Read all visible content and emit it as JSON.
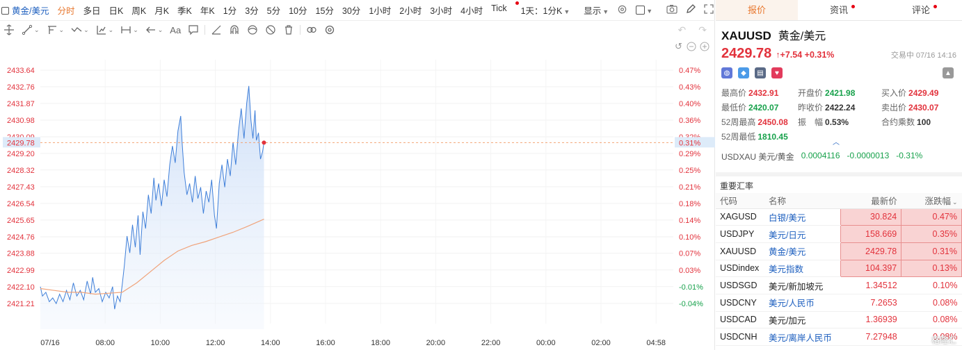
{
  "period_bar": {
    "symbol": "黄金/美元",
    "items": [
      "分时",
      "多日",
      "日K",
      "周K",
      "月K",
      "季K",
      "年K",
      "1分",
      "3分",
      "5分",
      "10分",
      "15分",
      "30分",
      "1小时",
      "2小时",
      "3小时",
      "4小时",
      "Tick"
    ],
    "active_index": 0,
    "combo": "1天：1分K",
    "display": "显示"
  },
  "drawing_tools": [
    "crosshair",
    "line",
    "polyline",
    "trend",
    "fib",
    "measure",
    "arrow",
    "text",
    "comment",
    "ruler",
    "magnet",
    "eye",
    "hide",
    "delete",
    "link",
    "settings"
  ],
  "chart_data": {
    "type": "line",
    "date_label": "07/16",
    "x_ticks": [
      "07/16",
      "08:00",
      "10:00",
      "12:00",
      "14:00",
      "16:00",
      "18:00",
      "20:00",
      "22:00",
      "00:00",
      "02:00",
      "04:58"
    ],
    "y_left_ticks": [
      "2433.64",
      "2432.76",
      "2431.87",
      "2430.98",
      "2430.09",
      "2429.20",
      "2428.32",
      "2427.43",
      "2426.54",
      "2425.65",
      "2424.76",
      "2423.88",
      "2422.99",
      "2422.10",
      "2421.21"
    ],
    "y_right_ticks": [
      "0.47%",
      "0.43%",
      "0.40%",
      "0.36%",
      "0.32%",
      "0.29%",
      "0.25%",
      "0.21%",
      "0.18%",
      "0.14%",
      "0.10%",
      "0.07%",
      "0.03%",
      "-0.01%",
      "-0.04%"
    ],
    "ylim": [
      2420.5,
      2434.2
    ],
    "last_price": "2429.78",
    "last_pct": "0.31%",
    "price_series": [
      [
        0,
        2422.1
      ],
      [
        3,
        2421.6
      ],
      [
        8,
        2421.8
      ],
      [
        13,
        2421.3
      ],
      [
        18,
        2421.5
      ],
      [
        23,
        2421.2
      ],
      [
        28,
        2421.7
      ],
      [
        33,
        2421.3
      ],
      [
        38,
        2421.9
      ],
      [
        43,
        2421.4
      ],
      [
        48,
        2422.3
      ],
      [
        53,
        2421.6
      ],
      [
        58,
        2421.9
      ],
      [
        63,
        2421.4
      ],
      [
        68,
        2422.4
      ],
      [
        73,
        2421.7
      ],
      [
        76,
        2422.6
      ],
      [
        80,
        2421.8
      ],
      [
        85,
        2422.0
      ],
      [
        90,
        2421.3
      ],
      [
        95,
        2421.8
      ],
      [
        100,
        2421.5
      ],
      [
        105,
        2422.1
      ],
      [
        108,
        2420.9
      ],
      [
        112,
        2421.6
      ],
      [
        116,
        2421.3
      ],
      [
        119,
        2422.2
      ],
      [
        122,
        2423.2
      ],
      [
        126,
        2424.8
      ],
      [
        130,
        2423.9
      ],
      [
        134,
        2425.4
      ],
      [
        138,
        2424.2
      ],
      [
        142,
        2425.9
      ],
      [
        145,
        2423.8
      ],
      [
        149,
        2426.1
      ],
      [
        153,
        2425.2
      ],
      [
        157,
        2427.0
      ],
      [
        161,
        2426.0
      ],
      [
        165,
        2427.9
      ],
      [
        168,
        2426.7
      ],
      [
        172,
        2427.6
      ],
      [
        176,
        2426.4
      ],
      [
        180,
        2427.8
      ],
      [
        184,
        2426.9
      ],
      [
        188,
        2428.6
      ],
      [
        192,
        2429.6
      ],
      [
        196,
        2428.7
      ],
      [
        200,
        2430.4
      ],
      [
        204,
        2431.2
      ],
      [
        206,
        2429.8
      ],
      [
        209,
        2428.2
      ],
      [
        213,
        2427.0
      ],
      [
        217,
        2427.6
      ],
      [
        221,
        2426.6
      ],
      [
        225,
        2428.0
      ],
      [
        229,
        2426.8
      ],
      [
        233,
        2427.4
      ],
      [
        237,
        2426.0
      ],
      [
        241,
        2427.2
      ],
      [
        245,
        2426.6
      ],
      [
        249,
        2427.8
      ],
      [
        253,
        2425.9
      ],
      [
        256,
        2425.2
      ],
      [
        260,
        2427.6
      ],
      [
        264,
        2428.6
      ],
      [
        268,
        2427.4
      ],
      [
        272,
        2428.9
      ],
      [
        276,
        2428.0
      ],
      [
        280,
        2429.8
      ],
      [
        284,
        2428.6
      ],
      [
        288,
        2430.4
      ],
      [
        292,
        2431.6
      ],
      [
        296,
        2430.0
      ],
      [
        300,
        2431.9
      ],
      [
        303,
        2432.8
      ],
      [
        306,
        2431.0
      ],
      [
        309,
        2430.0
      ],
      [
        312,
        2431.5
      ],
      [
        314,
        2429.9
      ],
      [
        317,
        2430.3
      ],
      [
        320,
        2428.9
      ],
      [
        323,
        2429.3
      ],
      [
        325,
        2429.8
      ]
    ],
    "avg_series": [
      [
        0,
        2422.0
      ],
      [
        20,
        2421.9
      ],
      [
        40,
        2421.8
      ],
      [
        60,
        2421.8
      ],
      [
        80,
        2421.7
      ],
      [
        100,
        2421.75
      ],
      [
        119,
        2421.8
      ],
      [
        140,
        2422.3
      ],
      [
        160,
        2422.9
      ],
      [
        180,
        2423.5
      ],
      [
        200,
        2424.0
      ],
      [
        220,
        2424.3
      ],
      [
        240,
        2424.5
      ],
      [
        260,
        2424.75
      ],
      [
        280,
        2425.0
      ],
      [
        300,
        2425.3
      ],
      [
        325,
        2425.7
      ]
    ]
  },
  "tabs": [
    "报价",
    "资讯",
    "评论"
  ],
  "quote": {
    "symbol": "XAUUSD",
    "name": "黄金/美元",
    "price": "2429.78",
    "arrow": "↑",
    "change": "+7.54",
    "change_pct": "+0.31%",
    "status": "交易中 07/16 14:16"
  },
  "stats": [
    {
      "label": "最高价",
      "value": "2432.91",
      "color": "red"
    },
    {
      "label": "开盘价",
      "value": "2421.98",
      "color": "green"
    },
    {
      "label": "买入价",
      "value": "2429.49",
      "color": "red"
    },
    {
      "label": "最低价",
      "value": "2420.07",
      "color": "green"
    },
    {
      "label": "昨收价",
      "value": "2422.24",
      "color": "dark"
    },
    {
      "label": "卖出价",
      "value": "2430.07",
      "color": "red"
    },
    {
      "label": "52周最高",
      "value": "2450.08",
      "color": "red"
    },
    {
      "label": "振　幅",
      "value": "0.53%",
      "color": "dark"
    },
    {
      "label": "合约乘数",
      "value": "100",
      "color": "dark"
    },
    {
      "label": "52周最低",
      "value": "1810.45",
      "color": "green"
    }
  ],
  "usdxau": {
    "label": "USDXAU 美元/黄金",
    "price": "0.0004116",
    "change": "-0.0000013",
    "pct": "-0.31%"
  },
  "rates": {
    "title": "重要汇率",
    "headers": [
      "代码",
      "名称",
      "最新价",
      "涨跌幅"
    ],
    "rows": [
      {
        "code": "XAGUSD",
        "name": "白银/美元",
        "price": "30.824",
        "pct": "0.47%"
      },
      {
        "code": "USDJPY",
        "name": "美元/日元",
        "price": "158.669",
        "pct": "0.35%"
      },
      {
        "code": "XAUUSD",
        "name": "黄金/美元",
        "price": "2429.78",
        "pct": "0.31%"
      },
      {
        "code": "USDindex",
        "name": "美元指数",
        "price": "104.397",
        "pct": "0.13%"
      },
      {
        "code": "USDSGD",
        "name": "美元/新加坡元",
        "price": "1.34512",
        "pct": "0.10%"
      },
      {
        "code": "USDCNY",
        "name": "美元/人民币",
        "price": "7.2653",
        "pct": "0.08%"
      },
      {
        "code": "USDCAD",
        "name": "美元/加元",
        "price": "1.36939",
        "pct": "0.08%"
      },
      {
        "code": "USDCNH",
        "name": "美元/离岸人民币",
        "price": "7.27948",
        "pct": "0.08%"
      }
    ]
  },
  "watermark": "格隆汇"
}
